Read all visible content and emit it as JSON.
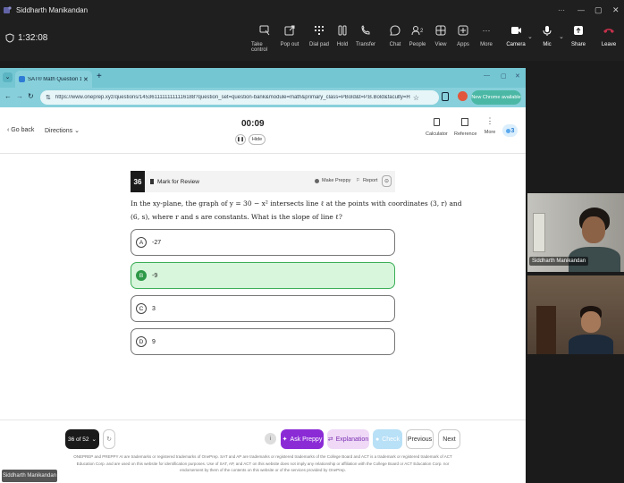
{
  "teams": {
    "window_title": "Siddharth Manikandan",
    "call_timer": "1:32:08",
    "toolbar": [
      {
        "label": "Take control",
        "icon": "take-control-icon"
      },
      {
        "label": "Pop out",
        "icon": "pop-out-icon"
      },
      {
        "label": "Dial pad",
        "icon": "dial-pad-icon"
      },
      {
        "label": "Hold",
        "icon": "hold-icon"
      },
      {
        "label": "Transfer",
        "icon": "transfer-icon"
      },
      {
        "label": "Chat",
        "icon": "chat-icon"
      },
      {
        "label": "People",
        "icon": "people-icon",
        "badge": "2"
      },
      {
        "label": "View",
        "icon": "view-icon"
      },
      {
        "label": "Apps",
        "icon": "apps-icon"
      },
      {
        "label": "More",
        "icon": "more-icon"
      },
      {
        "label": "Camera",
        "icon": "camera-icon"
      },
      {
        "label": "Mic",
        "icon": "mic-icon"
      },
      {
        "label": "Share",
        "icon": "share-icon"
      },
      {
        "label": "Leave",
        "icon": "leave-icon"
      }
    ],
    "participants": [
      {
        "name": "Siddharth Manikandan"
      },
      {
        "name": ""
      }
    ],
    "self_label": "Siddharth Manikandan"
  },
  "browser": {
    "tab_title": "SAT® Math Question 145361...",
    "url": "https://www.oneprep.xyz/questions/14536111111111116188?question_set=question-bank&module=math&primary_class=PBold&t=P.B.Bold&faculty=H",
    "chrome_badge": "New Chrome available"
  },
  "app": {
    "go_back": "Go back",
    "directions": "Directions",
    "timer": "00:09",
    "hide": "Hide",
    "tools": [
      {
        "label": "Calculator",
        "icon": "calculator-icon"
      },
      {
        "label": "Reference",
        "icon": "reference-icon"
      },
      {
        "label": "More",
        "icon": "more-vertical-icon"
      }
    ],
    "streak": "3"
  },
  "question": {
    "number": "36",
    "mark_label": "Mark for Review",
    "make_preppy": "Make Preppy",
    "report": "Report",
    "text_line1": "In the xy-plane, the graph of y = 30 − x² intersects line ℓ at the points with coordinates (3, r) and",
    "text_line2": "(6, s), where r and s are constants. What is the slope of line ℓ?",
    "choices": [
      {
        "letter": "A",
        "text": "-27",
        "selected": false
      },
      {
        "letter": "B",
        "text": "-9",
        "selected": true
      },
      {
        "letter": "C",
        "text": "3",
        "selected": false
      },
      {
        "letter": "D",
        "text": "9",
        "selected": false
      }
    ]
  },
  "footer": {
    "progress": "36 of 52",
    "ask_preppy": "Ask Preppy",
    "explanation": "Explanation",
    "check": "Check",
    "previous": "Previous",
    "next": "Next",
    "disclaimer": "ONEPREP and PREPPY AI are trademarks or registered trademarks of OnePrep. SAT and AP are trademarks or registered trademarks of the College Board and ACT is a trademark or registered trademark of ACT Education Corp. and are used on this website for identification purposes. Use of SAT, AP, and ACT on this website does not imply any relationship or affiliation with the College Board or ACT Education Corp. nor endorsement by them of the contents on this website or of the services provided by OnePrep."
  },
  "colors": {
    "teams_bg": "#1f1f1f",
    "browser_tab_bg": "#74c6d2",
    "selected_green": "#2e9947",
    "ask_preppy_purple": "#8b2bd6",
    "leave_red": "#c4314b"
  }
}
